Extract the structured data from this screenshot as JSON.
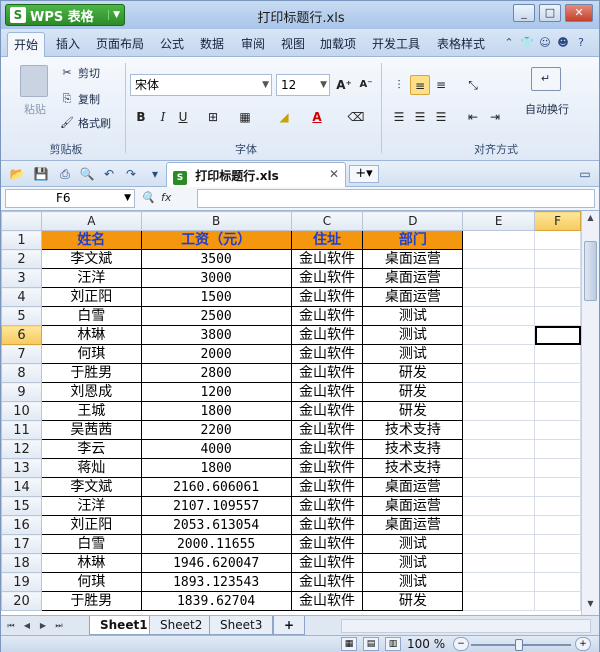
{
  "app": {
    "brand": "WPS 表格",
    "window_title": "打印标题行.xls"
  },
  "menu": {
    "tabs": [
      "开始",
      "插入",
      "页面布局",
      "公式",
      "数据",
      "审阅",
      "视图",
      "加载项",
      "开发工具",
      "表格样式"
    ]
  },
  "ribbon": {
    "clipboard": {
      "paste": "粘贴",
      "cut": "剪切",
      "copy": "复制",
      "format_painter": "格式刷",
      "group": "剪贴板"
    },
    "font": {
      "name": "宋体",
      "size": "12",
      "bold": "B",
      "italic": "I",
      "underline": "U",
      "grow": "A⁺",
      "shrink": "A⁻",
      "color_letter": "A",
      "group": "字体"
    },
    "align": {
      "wrap": "自动换行",
      "group": "对齐方式"
    }
  },
  "doc_tab": {
    "name": "打印标题行.xls"
  },
  "formula_bar": {
    "cell_ref": "F6",
    "value": ""
  },
  "sheet": {
    "columns": [
      "A",
      "B",
      "C",
      "D",
      "E",
      "F"
    ],
    "rows": [
      [
        "姓名",
        "工资（元）",
        "住址",
        "部门"
      ],
      [
        "李文斌",
        "3500",
        "金山软件",
        "桌面运营"
      ],
      [
        "汪洋",
        "3000",
        "金山软件",
        "桌面运营"
      ],
      [
        "刘正阳",
        "1500",
        "金山软件",
        "桌面运营"
      ],
      [
        "白雪",
        "2500",
        "金山软件",
        "测试"
      ],
      [
        "林琳",
        "3800",
        "金山软件",
        "测试"
      ],
      [
        "何琪",
        "2000",
        "金山软件",
        "测试"
      ],
      [
        "于胜男",
        "2800",
        "金山软件",
        "研发"
      ],
      [
        "刘恩成",
        "1200",
        "金山软件",
        "研发"
      ],
      [
        "王城",
        "1800",
        "金山软件",
        "研发"
      ],
      [
        "吴茜茜",
        "2200",
        "金山软件",
        "技术支持"
      ],
      [
        "李云",
        "4000",
        "金山软件",
        "技术支持"
      ],
      [
        "蒋灿",
        "1800",
        "金山软件",
        "技术支持"
      ],
      [
        "李文斌",
        "2160.606061",
        "金山软件",
        "桌面运营"
      ],
      [
        "汪洋",
        "2107.109557",
        "金山软件",
        "桌面运营"
      ],
      [
        "刘正阳",
        "2053.613054",
        "金山软件",
        "桌面运营"
      ],
      [
        "白雪",
        "2000.11655",
        "金山软件",
        "测试"
      ],
      [
        "林琳",
        "1946.620047",
        "金山软件",
        "测试"
      ],
      [
        "何琪",
        "1893.123543",
        "金山软件",
        "测试"
      ],
      [
        "于胜男",
        "1839.62704",
        "金山软件",
        "研发"
      ]
    ]
  },
  "sheet_tabs": [
    "Sheet1",
    "Sheet2",
    "Sheet3"
  ],
  "status": {
    "zoom": "100 %"
  },
  "colors": {
    "header_fill": "#f5960f",
    "header_text": "#1f3fd0",
    "selection": "#f7c95e"
  }
}
